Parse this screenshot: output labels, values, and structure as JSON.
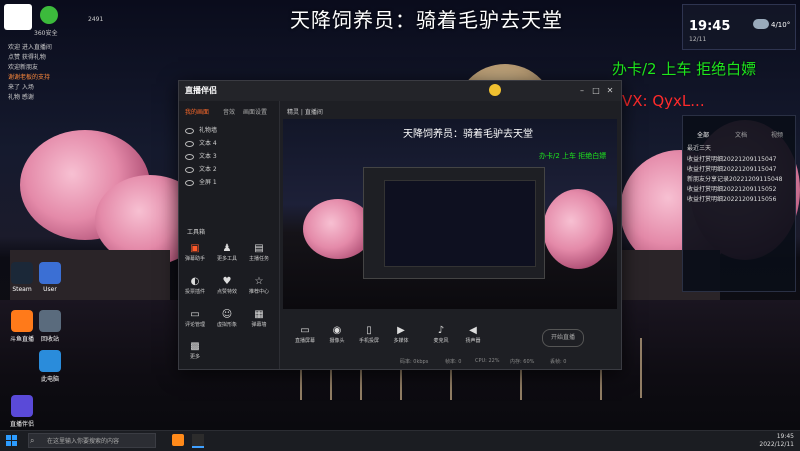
{
  "overlay": {
    "title": "天降饲养员：骑着毛驴去天堂",
    "ad_line1": "办卡/2  上车  拒绝白嫖",
    "ad_vx": "VX: QyxL..."
  },
  "chat": {
    "stat1": "2491",
    "stat2": "360安全",
    "lines": [
      "欢迎 进入直播间",
      "点赞 获得礼物",
      "欢迎新朋友",
      "谢谢老板的支持",
      "来了 入场",
      "礼物 感谢"
    ]
  },
  "desktop_icons": [
    {
      "label": "Steam"
    },
    {
      "label": "User"
    },
    {
      "label": "回收站"
    },
    {
      "label": "此电脑"
    },
    {
      "label": "斗鱼直播"
    },
    {
      "label": "直播伴侣"
    }
  ],
  "clock_widget": {
    "time": "19:45",
    "date": "12/11",
    "temp": "4/10°"
  },
  "notif_panel": {
    "tabs": [
      "全部",
      "文档",
      "视频"
    ],
    "section": "最近三天",
    "items": [
      "收益打赏明细20221209115047",
      "收益打赏明细20221209115047",
      "新朋友分享记录20221209115048",
      "收益打赏明细20221209115052",
      "收益打赏明细20221209115056"
    ]
  },
  "app": {
    "logo": "直播伴侣",
    "tabs": [
      "我的画面",
      "音效",
      "画面设置"
    ],
    "scenes": [
      "礼物墙",
      "文本 4",
      "文本 3",
      "文本 2",
      "全屏 1"
    ],
    "tools_title": "工具箱",
    "tools": [
      "弹幕助手",
      "更多工具",
      "主播任务",
      "投票插件",
      "点赞特效",
      "推荐中心",
      "评论管理",
      "虚拟形象",
      "弹幕墙",
      "更多"
    ],
    "preview_header": "精灵 | 直播间",
    "preview_title": "天降饲养员：骑着毛驴去天堂",
    "preview_green": "办卡/2  上车  拒绝白嫖",
    "bottom_tools": [
      "直播屏幕",
      "摄像头",
      "手机投屏",
      "多媒体",
      "麦克风",
      "扬声器"
    ],
    "start_btn": "开始直播",
    "status": [
      "码率: 0kbps",
      "帧率: 0",
      "CPU: 22%",
      "内存: 60%",
      "丢帧: 0"
    ]
  },
  "taskbar": {
    "search_placeholder": "在这里输入你要搜索的内容",
    "time": "19:45",
    "date": "2022/12/11"
  }
}
